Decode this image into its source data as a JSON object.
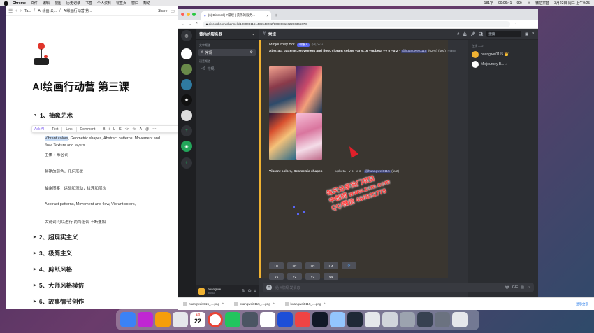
{
  "menubar": {
    "app_name": "Chrome",
    "items": [
      "文件",
      "编辑",
      "视图",
      "历史记录",
      "书签",
      "个人资料",
      "标签页",
      "窗口",
      "帮助"
    ],
    "status": [
      "181字",
      "00:06:41",
      "99+",
      "✉",
      "微信拼音",
      "3月22日 周三 上午9:25"
    ]
  },
  "notion": {
    "breadcrumb": [
      "Ta...",
      "AI 绘画 公...",
      "AI绘画行动营 第..."
    ],
    "share_label": "Share",
    "page_title": "AI绘画行动营 第三课",
    "headings": [
      "1、抽象艺术",
      "2、超现实主义",
      "3、极简主义",
      "4、剪纸风格",
      "5、大师风格模仿",
      "6、故事情节创作"
    ],
    "toolbar": {
      "ask_ai": "Ask AI",
      "text": "Text",
      "link": "Link",
      "comment": "Comment",
      "formats": [
        "B",
        "i",
        "U",
        "S",
        "<>",
        "√x",
        "A"
      ]
    },
    "line1_highlight": "Vibrant colors",
    "line1_rest": ", Geometric shapes, Abstract patterns, Movement and",
    "line2": "flow, Texture and layers",
    "line3": "主体 + 形容词",
    "line4": "鲜艳的颜色，几何形状",
    "line5": "抽象图案，运动和流动，纹理和层次",
    "line6": "Abstract patterns, Movement and flow, Vibrant colors,",
    "line7": "关键词 可以进行 两两组合 不断叠加"
  },
  "chrome": {
    "tab_title": "(6) Discord | #常规 | 黄伟的服务...",
    "url": "discord.com/channels/1080081161436549202/1080081162286365078",
    "traffic_colors": [
      "#ff5f57",
      "#febc2e",
      "#28c840"
    ]
  },
  "discord": {
    "server_name": "黄伟的服务器",
    "text_category": "文字频道",
    "text_channel": "常规",
    "voice_category": "语音频道",
    "voice_channel": "常规",
    "channel_header": "常规",
    "search_placeholder": "搜索",
    "user_name": "huangwei...",
    "user_tag": "#0083",
    "message": {
      "author": "Midjourney Bot",
      "bot_badge": "✓ 机器人",
      "timestamp": "今天 00:24",
      "prompt_bold": "Abstract patterns, Movement and flow, Vibrant colors --ar 9:16 --upbeta --v 5 --q 2",
      "prompt_mention": "@huangwei0115",
      "prompt_suffix": "(62%) (fast)",
      "prompt_tail": "(已编辑)",
      "second_prompt_bold": "Vibrant colors, Geometric shapes",
      "second_prompt_mid": "--upbeta --v 5 --q 2 -",
      "second_prompt_mention": "@huangwei0115",
      "second_prompt_suffix": "(fast)"
    },
    "upscale_buttons": [
      "U1",
      "U2",
      "U3",
      "U4",
      "⟳"
    ],
    "variation_buttons": [
      "V1",
      "V2",
      "V3",
      "V4"
    ],
    "composer_placeholder": "给 #常规 发消息",
    "members_category": "在线 — 2",
    "members": [
      "huangwei0115 👑",
      "Midjourney B... ✓"
    ]
  },
  "watermark": {
    "line1": "每天分享热门项目",
    "line2": "中创网 www.zcm.com",
    "line3": "QQ/微信 466832778"
  },
  "downloads": {
    "files": [
      "huangwei0115_....png",
      "huangwei0115_....png",
      "huangwei0115_....png"
    ],
    "show_all": "显示全部"
  },
  "dock": {
    "calendar_month": "3月",
    "calendar_day": "22"
  }
}
